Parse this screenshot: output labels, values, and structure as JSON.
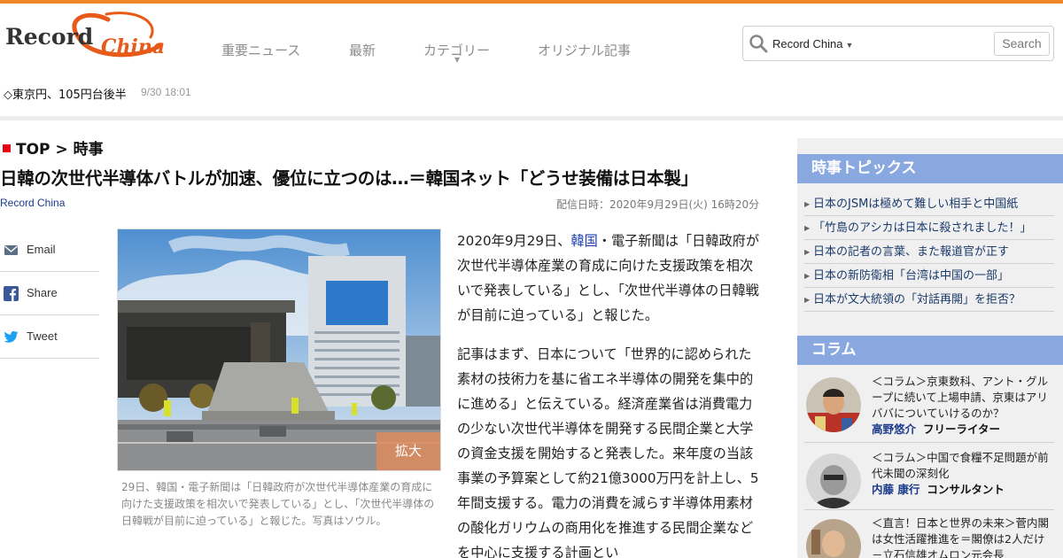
{
  "header": {
    "logo_text_a": "Record",
    "logo_text_b": "China",
    "nav": [
      "重要ニュース",
      "最新",
      "カテゴリー",
      "オリジナル記事"
    ],
    "search": {
      "site": "Record China",
      "button": "Search"
    }
  },
  "ticker": {
    "text": "◇東京円、105円台後半",
    "time": "9/30 18:01"
  },
  "breadcrumb": {
    "top": "TOP",
    "sep": ">",
    "section": "時事"
  },
  "article": {
    "title": "日韓の次世代半導体バトルが加速、優位に立つのは…＝韓国ネット「どうせ装備は日本製」",
    "source": "Record China",
    "date": "配信日時：2020年9月29日(火) 16時20分",
    "photo_zoom": "拡大",
    "caption": "29日、韓国・電子新聞は「日韓政府が次世代半導体産業の育成に向けた支援政策を相次いで発表している」とし、「次世代半導体の日韓戦が目前に迫っている」と報じた。写真はソウル。",
    "p1_pre": "2020年9月29日、",
    "p1_link": "韓国",
    "p1_post": "・電子新聞は「日韓政府が次世代半導体産業の育成に向けた支援政策を相次いで発表している」とし、「次世代半導体の日韓戦が目前に迫っている」と報じた。",
    "p2": "記事はまず、日本について「世界的に認められた素材の技術力を基に省エネ半導体の開発を集中的に進める」と伝えている。経済産業省は消費電力の少ない次世代半導体を開発する民間企業と大学の資金支援を開始すると発表した。来年度の当該事業の予算案として約21億3000万円を計上し、5年間支援する。電力の消費を減らす半導体用素材の酸化ガリウムの商用化を推進する民間企業などを中心に支援する計画とい"
  },
  "share": [
    "Email",
    "Share",
    "Tweet"
  ],
  "sidebar": {
    "topics_heading": "時事トピックス",
    "topics": [
      "日本のJSMは極めて難しい相手と中国紙",
      "「竹島のアシカは日本に殺されました！」",
      "日本の記者の言葉、また報道官が正す",
      "日本の新防衛相「台湾は中国の一部」",
      "日本が文大統領の「対話再開」を拒否？"
    ],
    "column_heading": "コラム",
    "columns": [
      {
        "text": "＜コラム＞京東数科、アント・グループに続いて上場申請、京東はアリババについていけるのか？",
        "author": "高野悠介",
        "role": "フリーライター"
      },
      {
        "text": "＜コラム＞中国で食糧不足問題が前代未聞の深刻化",
        "author": "内藤 康行",
        "role": "コンサルタント"
      },
      {
        "text": "＜直言！日本と世界の未来＞菅内閣は女性活躍推進を＝閣僚は2人だけ－立石信雄オムロン元会長",
        "author": "",
        "role": ""
      }
    ]
  },
  "colors": {
    "accent": "#f0862a",
    "brand_red": "#e60012",
    "sidebar_head": "#8aa8e0",
    "link": "#1a3fb0"
  }
}
